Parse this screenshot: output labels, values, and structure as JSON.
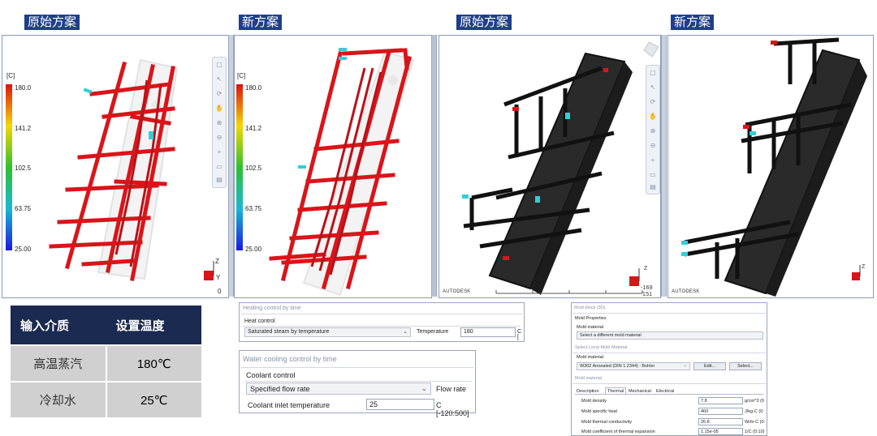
{
  "titles": [
    "原始方案",
    "新方案",
    "原始方案",
    "新方案"
  ],
  "legend": {
    "unit": "[C]",
    "ticks": [
      "180.0",
      "141.2",
      "102.5",
      "63.75",
      "25.00"
    ]
  },
  "viewer": {
    "brand": "AUTODESK",
    "axis_z": "Z",
    "axis_y": "Y",
    "axis_x": "X",
    "readout_a": "-168",
    "readout_b": "151",
    "panel1_corner": "0"
  },
  "colors": {
    "hot": "#d9151a",
    "inlet": "#2fd0d8",
    "title_bg": "#1f3f8a",
    "mold": "#2a2a2a"
  },
  "media_table": {
    "headers": [
      "输入介质",
      "设置温度"
    ],
    "rows": [
      {
        "medium": "高温蒸汽",
        "temp": "180℃"
      },
      {
        "medium": "冷却水",
        "temp": "25℃"
      }
    ]
  },
  "heating_dialog": {
    "title": "Heating control by time",
    "section": "Heat control",
    "select_value": "Saturated steam by temperature",
    "temp_label": "Temperature",
    "temp_value": "180",
    "unit": "C ["
  },
  "cooling_dialog": {
    "title": "Water cooling control by time",
    "section": "Coolant control",
    "select_value": "Specified flow rate",
    "flow_label": "Flow rate",
    "inlet_label": "Coolant inlet temperature",
    "inlet_value": "25",
    "inlet_unit": "C [-120:500]"
  },
  "mold_dialog": {
    "title": "Mold block (3D)",
    "props_header": "Mold Properties",
    "mold_material_label": "Mold material",
    "select_different": "Select a different mold material",
    "local_header": "Select Local Mold Material",
    "mold_material_label2": "Mold material",
    "material_value": "W302 Annealed (DIN 1.2344) : Bohler",
    "edit_btn": "Edit...",
    "select_btn": "Select...",
    "mm_header": "Mold material",
    "tabs": [
      "Description",
      "Thermal",
      "Mechanical",
      "Electrical"
    ],
    "properties": [
      {
        "label": "Mold density",
        "value": "7.8",
        "unit": "g/cm^3 (0"
      },
      {
        "label": "Mold specific heat",
        "value": "460",
        "unit": "J/kg-C (0:"
      },
      {
        "label": "Mold thermal conductivity",
        "value": "26.8",
        "unit": "W/m-C (0:"
      },
      {
        "label": "Mold coefficient of thermal expansion",
        "value": "1.15e-05",
        "unit": "1/C (0:10)"
      }
    ]
  }
}
